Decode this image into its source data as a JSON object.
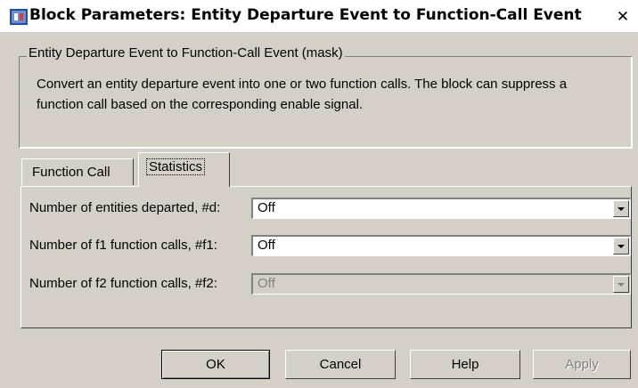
{
  "window": {
    "title": "Block Parameters: Entity Departure Event to Function-Call Event",
    "close_glyph": "✕"
  },
  "group": {
    "legend": "Entity Departure Event to Function-Call Event (mask)",
    "description": "Convert an entity departure event into one or two function calls. The block can suppress a function call based on the corresponding enable signal."
  },
  "tabs": [
    {
      "label": "Function Call",
      "selected": false
    },
    {
      "label": "Statistics",
      "selected": true
    }
  ],
  "params": [
    {
      "label": "Number of entities departed, #d:",
      "value": "Off",
      "enabled": true
    },
    {
      "label": "Number of f1 function calls, #f1:",
      "value": "Off",
      "enabled": true
    },
    {
      "label": "Number of f2 function calls, #f2:",
      "value": "Off",
      "enabled": false
    }
  ],
  "buttons": {
    "ok": "OK",
    "cancel": "Cancel",
    "help": "Help",
    "apply": "Apply"
  },
  "icons": {
    "app": "block-parameters-icon",
    "close": "close-icon",
    "dropdown": "chevron-down-icon"
  }
}
